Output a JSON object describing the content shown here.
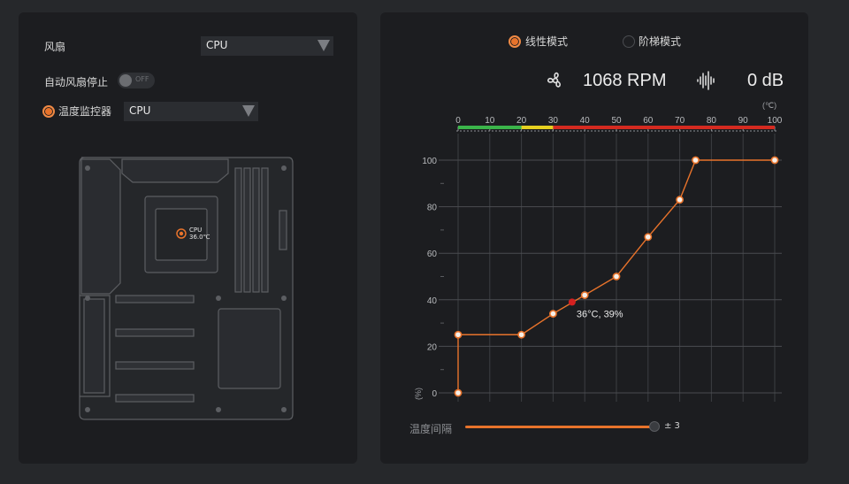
{
  "left": {
    "fan_label": "风扇",
    "fan_select": "CPU",
    "auto_stop_label": "自动风扇停止",
    "auto_stop_toggle": "OFF",
    "temp_monitor_label": "温度监控器",
    "temp_monitor_select": "CPU",
    "board_sensor": {
      "name": "CPU",
      "temp": "36.0℃"
    }
  },
  "right": {
    "modes": [
      {
        "label": "线性模式",
        "selected": true
      },
      {
        "label": "阶梯模式",
        "selected": false
      }
    ],
    "fan_speed": "1068 RPM",
    "noise": "0 dB",
    "temp_interval_label": "温度间隔",
    "temp_interval_value": "± 3",
    "temp_interval_fraction": 1.0
  },
  "colors": {
    "accent": "#e8732b",
    "panel": "#1c1d20",
    "background": "#26282b",
    "current_point": "#d42020"
  },
  "icons": [
    "fan-icon",
    "sound-wave-icon",
    "chevron-down-icon"
  ],
  "chart_data": {
    "type": "line",
    "xlabel": "(℃)",
    "ylabel": "(%)",
    "xlim": [
      0,
      100
    ],
    "ylim": [
      0,
      100
    ],
    "x_ticks": [
      "0",
      "10",
      "20",
      "30",
      "40",
      "50",
      "60",
      "70",
      "80",
      "90",
      "100"
    ],
    "y_ticks": [
      "0",
      "20",
      "40",
      "60",
      "80",
      "100"
    ],
    "series": [
      {
        "x": [
          0,
          0,
          20,
          30,
          40,
          50,
          60,
          70,
          75,
          100
        ],
        "y": [
          0,
          25,
          25,
          34,
          42,
          50,
          67,
          83,
          100,
          100
        ]
      }
    ],
    "current_point": {
      "x": 36,
      "y": 39,
      "label": "36°C, 39%"
    },
    "temp_bar": [
      {
        "from": 0,
        "to": 20,
        "color": "#3bb54a"
      },
      {
        "from": 20,
        "to": 30,
        "color": "#e6d020"
      },
      {
        "from": 30,
        "to": 100,
        "color": "#d42a20"
      }
    ],
    "grid": true
  }
}
